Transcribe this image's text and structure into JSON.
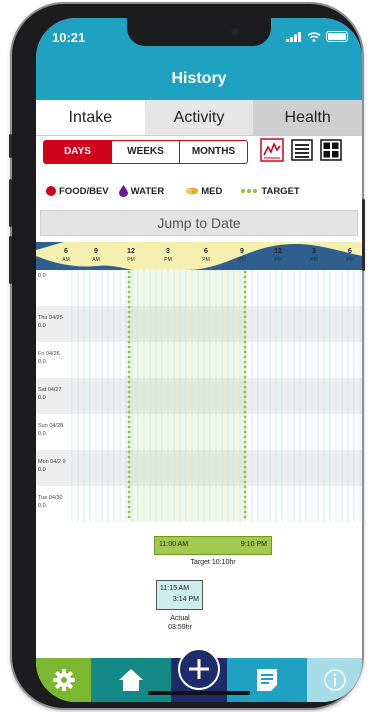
{
  "status": {
    "time": "10:21"
  },
  "header": {
    "title": "History"
  },
  "tabs": [
    {
      "label": "Intake"
    },
    {
      "label": "Activity"
    },
    {
      "label": "Health"
    }
  ],
  "range": {
    "days": "DAYS",
    "weeks": "WEEKS",
    "months": "MONTHS"
  },
  "views": [
    "line-chart-icon",
    "list-icon",
    "grid-icon"
  ],
  "legend": {
    "food": "FOOD/BEV",
    "water": "WATER",
    "med": "MED",
    "target": "TARGET"
  },
  "jump": {
    "label": "Jump to Date"
  },
  "timeline": {
    "hours": [
      {
        "num": "6",
        "ampm": "AM"
      },
      {
        "num": "9",
        "ampm": "AM"
      },
      {
        "num": "12",
        "ampm": "PM"
      },
      {
        "num": "3",
        "ampm": "PM"
      },
      {
        "num": "6",
        "ampm": "PM"
      },
      {
        "num": "9",
        "ampm": "PM"
      },
      {
        "num": "12",
        "ampm": "AM"
      },
      {
        "num": "3",
        "ampm": "AM"
      },
      {
        "num": "6",
        "ampm": "AM"
      }
    ],
    "days": [
      {
        "date": "",
        "value": "0.0"
      },
      {
        "date": "Thu 04/25",
        "value": "0.0"
      },
      {
        "date": "Fri 04/26",
        "value": "0.0"
      },
      {
        "date": "Sat 04/27",
        "value": "0.0"
      },
      {
        "date": "Sun 04/28",
        "value": "0.0"
      },
      {
        "date": "Mon 04/2 9",
        "value": "0.0"
      },
      {
        "date": "Tue 04/30",
        "value": "0.0"
      }
    ]
  },
  "summary": {
    "target_start": "11:00 AM",
    "target_end": "9:10 PM",
    "target_caption": "Target 10:10hr",
    "actual_start": "11:15 AM",
    "actual_end": "3:14 PM",
    "actual_caption_1": "Actual",
    "actual_caption_2": "03:59hr"
  },
  "colors": {
    "header": "#1fa2c2",
    "accent_red": "#d0021b",
    "target_green": "#8dc63f",
    "tab_settings": "#7cb82f",
    "tab_home": "#138a86",
    "tab_plus": "#1f2c6b",
    "tab_reports": "#1fa2c2",
    "tab_info": "#a7dbe8"
  },
  "tabbar": [
    "gear-icon",
    "home-icon",
    "plus-icon",
    "report-icon",
    "info-icon"
  ]
}
